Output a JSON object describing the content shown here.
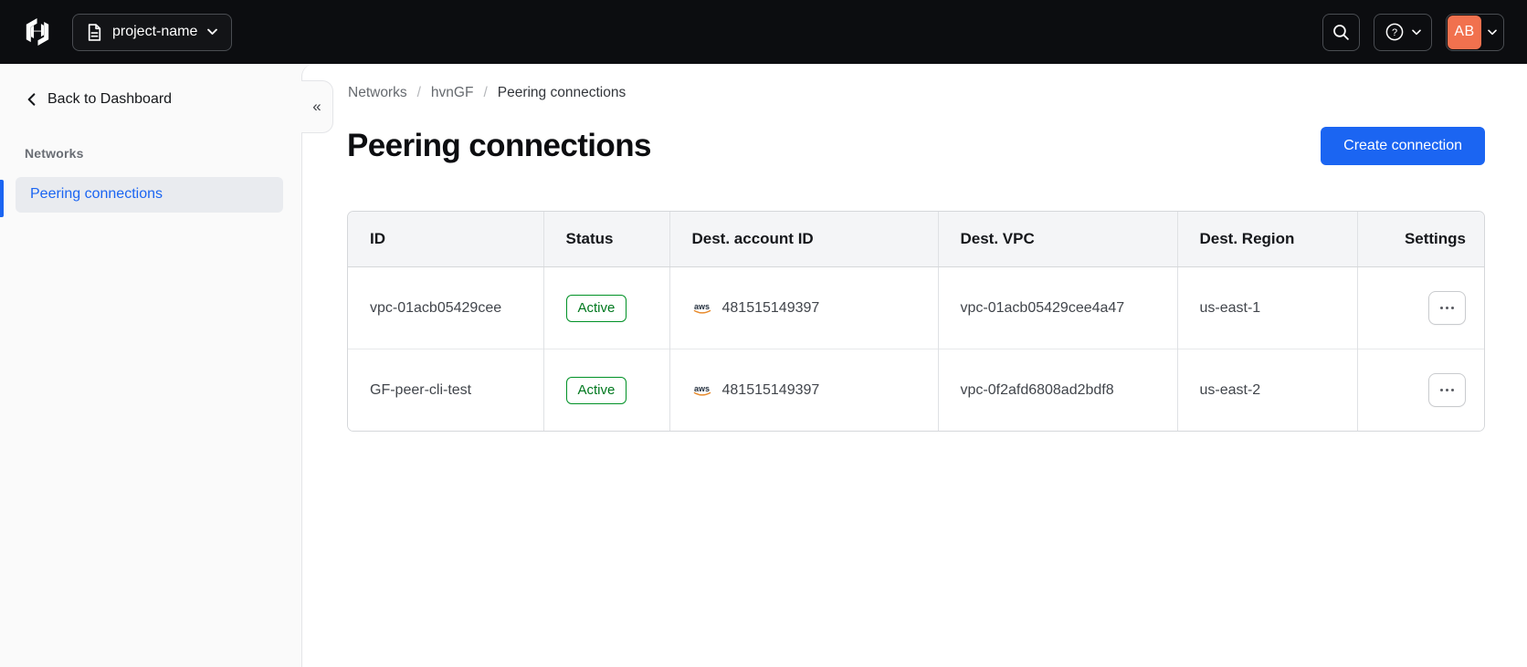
{
  "colors": {
    "accent_blue": "#1b65f2",
    "topbar_bg": "#0c0d10",
    "avatar_orange": "#f1714e",
    "success_green": "#00781e",
    "sidebar_bg": "#fafafa",
    "table_header_bg": "#f4f5f7",
    "aws_smile_orange": "#e88b2d"
  },
  "topbar": {
    "project_name": "project-name",
    "avatar_initials": "AB"
  },
  "sidebar": {
    "back_label": "Back to Dashboard",
    "section_label": "Networks",
    "items": [
      {
        "label": "Peering connections",
        "active": true
      }
    ],
    "collapse_glyph": "«"
  },
  "breadcrumb": {
    "separator": "/",
    "items": [
      "Networks",
      "hvnGF",
      "Peering connections"
    ]
  },
  "page": {
    "title": "Peering connections",
    "create_button_label": "Create connection"
  },
  "table": {
    "columns": [
      "ID",
      "Status",
      "Dest. account ID",
      "Dest. VPC",
      "Dest. Region",
      "Settings"
    ],
    "rows": [
      {
        "id": "vpc-01acb05429cee",
        "status": "Active",
        "dest_account_provider": "aws",
        "dest_account_id": "481515149397",
        "dest_vpc": "vpc-01acb05429cee4a47",
        "dest_region": "us-east-1"
      },
      {
        "id": "GF-peer-cli-test",
        "status": "Active",
        "dest_account_provider": "aws",
        "dest_account_id": "481515149397",
        "dest_vpc": "vpc-0f2afd6808ad2bdf8",
        "dest_region": "us-east-2"
      }
    ]
  }
}
